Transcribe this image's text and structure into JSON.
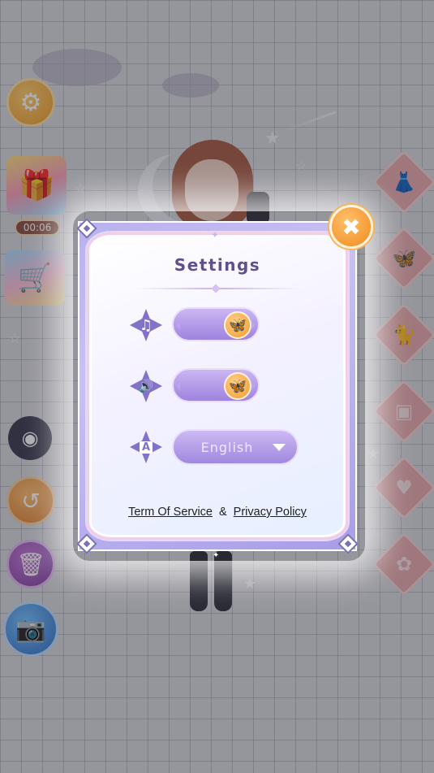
{
  "background": {
    "timer_text": "00:06"
  },
  "side_left": [
    {
      "name": "settings-button",
      "icon": "gear-icon",
      "glyph": "⚙"
    },
    {
      "name": "gift-box",
      "icon": "gift-icon",
      "glyph": "🎁"
    },
    {
      "name": "shop-cart",
      "icon": "cart-icon",
      "glyph": "🛒"
    },
    {
      "name": "eye-button",
      "icon": "eye-icon",
      "glyph": "◉"
    },
    {
      "name": "undo-button",
      "icon": "undo-icon",
      "glyph": "↺"
    },
    {
      "name": "trash-button",
      "icon": "trash-icon",
      "glyph": "🗑"
    },
    {
      "name": "camera-button",
      "icon": "camera-icon",
      "glyph": "📷"
    }
  ],
  "side_right": [
    {
      "name": "category-dress",
      "glyph": "👗"
    },
    {
      "name": "category-butterfly",
      "glyph": "🦋"
    },
    {
      "name": "category-pet",
      "glyph": "🐈"
    },
    {
      "name": "category-frame",
      "glyph": "▣"
    },
    {
      "name": "category-accessory",
      "glyph": "♥"
    },
    {
      "name": "category-flower",
      "glyph": "✿"
    }
  ],
  "dialog": {
    "title": "Settings",
    "close_glyph": "✖",
    "music": {
      "icon": "music-icon",
      "glyph": "♫",
      "enabled": true,
      "knob_glyph": "🦋"
    },
    "sound": {
      "icon": "speaker-icon",
      "glyph": "🔊",
      "enabled": true,
      "knob_glyph": "🦋"
    },
    "language": {
      "icon": "language-icon",
      "glyph": "A",
      "selected": "English"
    },
    "links": {
      "terms": "Term Of Service",
      "separator": "&",
      "privacy": "Privacy Policy"
    }
  },
  "colors": {
    "accent_orange": "#f29a2a",
    "dialog_purple": "#a99de8",
    "title_purple": "#5f4f8c"
  }
}
